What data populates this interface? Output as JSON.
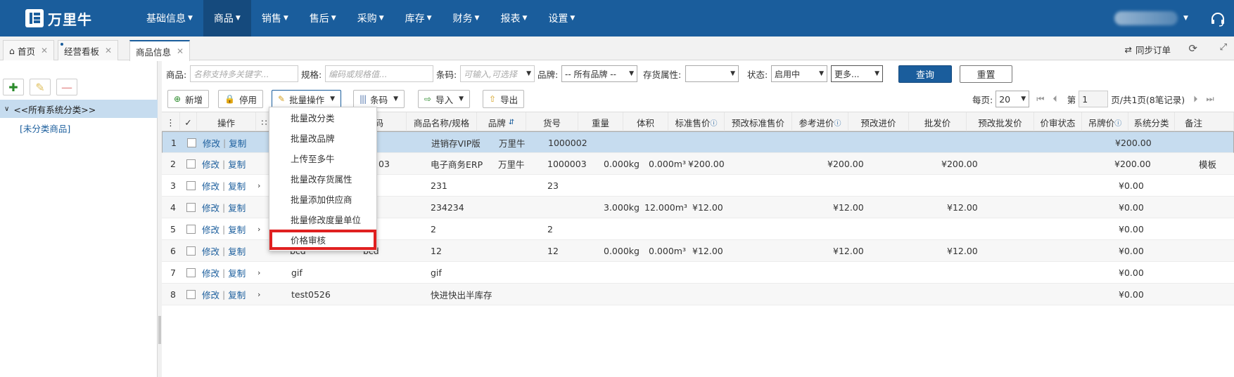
{
  "app": {
    "logo_text": "万里牛"
  },
  "nav": [
    {
      "label": "基础信息"
    },
    {
      "label": "商品"
    },
    {
      "label": "销售"
    },
    {
      "label": "售后"
    },
    {
      "label": "采购"
    },
    {
      "label": "库存"
    },
    {
      "label": "财务"
    },
    {
      "label": "报表"
    },
    {
      "label": "设置"
    }
  ],
  "tabs": [
    {
      "label": "首页"
    },
    {
      "label": "经营看板"
    },
    {
      "label": "商品信息"
    }
  ],
  "toolbar_right": {
    "sync_label": "同步订单"
  },
  "tree": {
    "root": "<<所有系统分类>>",
    "child": "[未分类商品]"
  },
  "filters": {
    "goods_label": "商品:",
    "goods_placeholder": "名称支持多关键字...",
    "spec_label": "规格:",
    "spec_placeholder": "编码或规格值...",
    "barcode_label": "条码:",
    "barcode_placeholder": "可输入,可选择",
    "brand_label": "品牌:",
    "brand_value": "-- 所有品牌 --",
    "stock_attr_label": "存货属性:",
    "stock_attr_value": "",
    "status_label": "状态:",
    "status_value": "启用中",
    "more_label": "更多...",
    "query_label": "查询",
    "reset_label": "重置"
  },
  "actions": {
    "add": "新增",
    "disable": "停用",
    "batch": "批量操作",
    "barcode": "条码",
    "import": "导入",
    "export": "导出"
  },
  "pager": {
    "per_page_label": "每页:",
    "per_page_value": "20",
    "page_prefix": "第",
    "page_value": "1",
    "page_suffix": "页/共1页(8笔记录)"
  },
  "columns": [
    "操作",
    "条码",
    "商品名称/规格",
    "品牌",
    "货号",
    "重量",
    "体积",
    "标准售价",
    "预改标准售价",
    "参考进价",
    "预改进价",
    "批发价",
    "预改批发价",
    "价审状态",
    "吊牌价",
    "系统分类",
    "备注"
  ],
  "row_actions": {
    "edit": "修改",
    "copy": "复制"
  },
  "rows": [
    {
      "no": "1",
      "code": "",
      "barcode": "",
      "name": "进销存VIP版",
      "brand": "万里牛",
      "sku": "1000002",
      "weight": "",
      "volume": "",
      "std_price": "",
      "ref_price": "",
      "wholesale": "",
      "tag_price": "¥200.00",
      "remark": ""
    },
    {
      "no": "2",
      "code": "",
      "barcode": "03",
      "name": "电子商务ERP",
      "brand": "万里牛",
      "sku": "1000003",
      "weight": "0.000kg",
      "volume": "0.000m³",
      "std_price": "¥200.00",
      "ref_price": "¥200.00",
      "wholesale": "¥200.00",
      "tag_price": "¥200.00",
      "remark": "模板"
    },
    {
      "no": "3",
      "code": "",
      "barcode": "",
      "name": "231",
      "brand": "",
      "sku": "23",
      "weight": "",
      "volume": "",
      "std_price": "",
      "ref_price": "",
      "wholesale": "",
      "tag_price": "¥0.00",
      "remark": ""
    },
    {
      "no": "4",
      "code": "",
      "barcode": "",
      "name": "234234",
      "brand": "",
      "sku": "",
      "weight": "3.000kg",
      "volume": "12.000m³",
      "std_price": "¥12.00",
      "ref_price": "¥12.00",
      "wholesale": "¥12.00",
      "tag_price": "¥0.00",
      "remark": ""
    },
    {
      "no": "5",
      "code": "",
      "barcode": "",
      "name": "2",
      "brand": "",
      "sku": "2",
      "weight": "",
      "volume": "",
      "std_price": "",
      "ref_price": "",
      "wholesale": "",
      "tag_price": "¥0.00",
      "remark": ""
    },
    {
      "no": "6",
      "code": "bcd",
      "barcode": "bcd",
      "name": "12",
      "brand": "",
      "sku": "12",
      "weight": "0.000kg",
      "volume": "0.000m³",
      "std_price": "¥12.00",
      "ref_price": "¥12.00",
      "wholesale": "¥12.00",
      "tag_price": "¥0.00",
      "remark": ""
    },
    {
      "no": "7",
      "code": "gif",
      "barcode": "",
      "name": "gif",
      "brand": "",
      "sku": "",
      "weight": "",
      "volume": "",
      "std_price": "",
      "ref_price": "",
      "wholesale": "",
      "tag_price": "¥0.00",
      "remark": ""
    },
    {
      "no": "8",
      "code": "test0526",
      "barcode": "",
      "name": "快进快出半库存",
      "brand": "",
      "sku": "",
      "weight": "",
      "volume": "",
      "std_price": "",
      "ref_price": "",
      "wholesale": "",
      "tag_price": "¥0.00",
      "remark": ""
    }
  ],
  "batch_menu": [
    "批量改分类",
    "批量改品牌",
    "上传至多牛",
    "批量改存货属性",
    "批量添加供应商",
    "批量修改度量单位",
    "价格审核"
  ],
  "colors": {
    "primary": "#1a5d9c",
    "selected_row": "#c6dcef",
    "highlight": "#e02020"
  }
}
